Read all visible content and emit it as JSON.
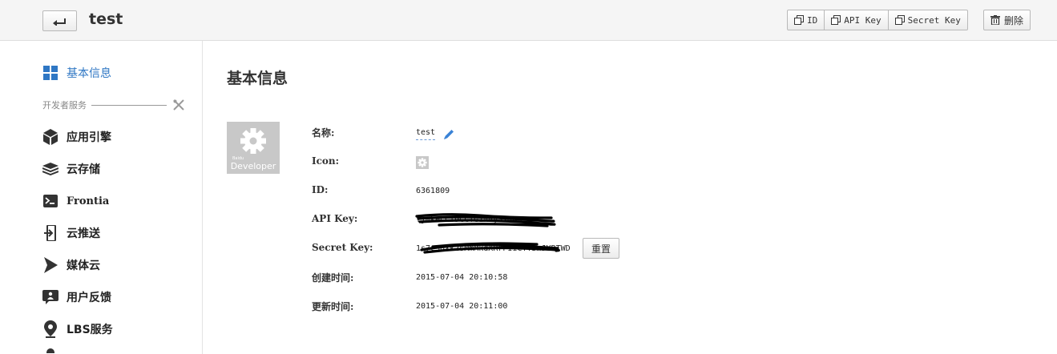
{
  "header": {
    "title": "test",
    "buttons": {
      "id": "ID",
      "api_key": "API Key",
      "secret_key": "Secret Key",
      "delete": "删除"
    }
  },
  "sidebar": {
    "basic_info": "基本信息",
    "section_label": "开发者服务",
    "items": [
      {
        "label": "应用引擎",
        "icon": "cube-icon"
      },
      {
        "label": "云存储",
        "icon": "layers-icon"
      },
      {
        "label": "Frontia",
        "icon": "terminal-icon"
      },
      {
        "label": "云推送",
        "icon": "push-icon"
      },
      {
        "label": "媒体云",
        "icon": "media-icon"
      },
      {
        "label": "用户反馈",
        "icon": "feedback-icon"
      },
      {
        "label": "LBS服务",
        "icon": "location-pin-icon"
      }
    ]
  },
  "main": {
    "title": "基本信息",
    "icon_box": {
      "small_text": "Baidu",
      "big_text": "Developer"
    },
    "fields": {
      "name_label": "名称:",
      "name_value": "test",
      "icon_label": "Icon:",
      "id_label": "ID:",
      "id_value": "6361809",
      "api_key_label": "API Key:",
      "api_key_value": "YjmkeCCT9CCTG1A4ySIJNS",
      "secret_key_label": "Secret Key:",
      "secret_key_value": "1s7c3dXk2sMmMkdXRrPIiCTY5mJYRTWD",
      "reset_label": "重置",
      "created_label": "创建时间:",
      "created_value": "2015-07-04 20:10:58",
      "updated_label": "更新时间:",
      "updated_value": "2015-07-04 20:11:00"
    }
  },
  "colors": {
    "accent": "#2f77c4",
    "topbar": "#f5f5f5",
    "icon_bg": "#c8c8c8"
  }
}
